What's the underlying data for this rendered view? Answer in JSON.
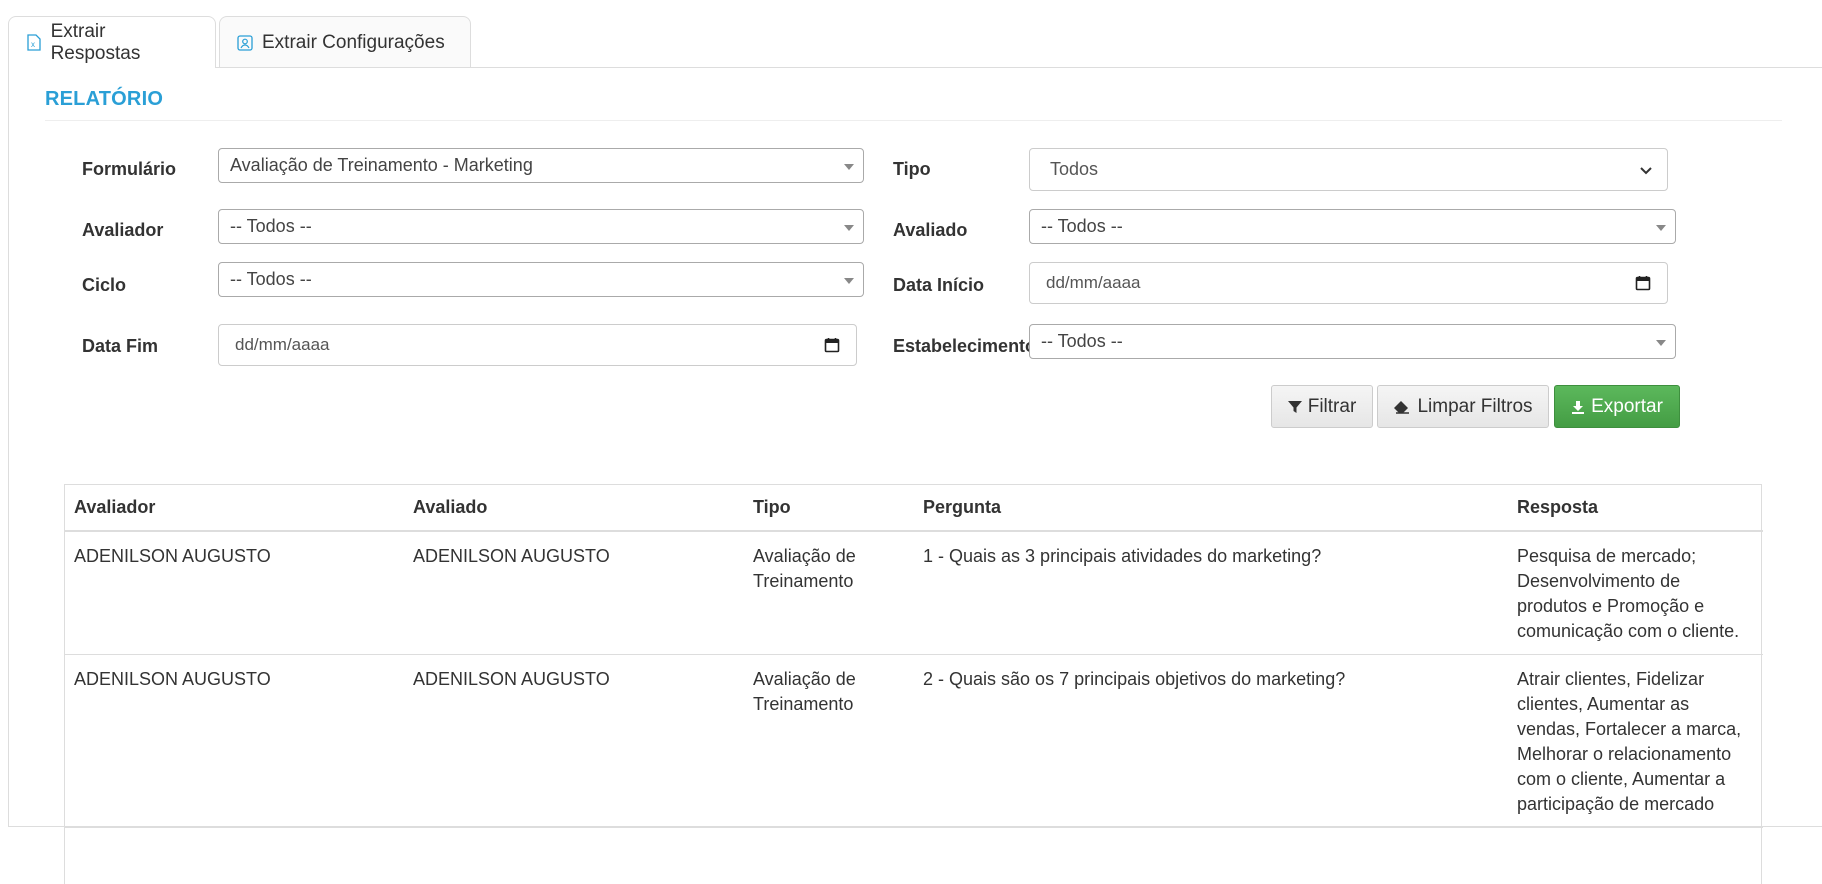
{
  "tabs": [
    {
      "label": "Extrair Respostas",
      "icon": "excel-file-icon"
    },
    {
      "label": "Extrair Configurações",
      "icon": "settings-file-icon"
    }
  ],
  "section_title": "RELATÓRIO",
  "filters": {
    "formulario": {
      "label": "Formulário",
      "value": "Avaliação de Treinamento - Marketing"
    },
    "tipo": {
      "label": "Tipo",
      "value": "Todos"
    },
    "avaliador": {
      "label": "Avaliador",
      "value": "-- Todos --"
    },
    "avaliado": {
      "label": "Avaliado",
      "value": "-- Todos --"
    },
    "ciclo": {
      "label": "Ciclo",
      "value": "-- Todos --"
    },
    "data_inicio": {
      "label": "Data Início",
      "placeholder": "dd/mm/aaaa"
    },
    "data_fim": {
      "label": "Data Fim",
      "placeholder": "dd/mm/aaaa"
    },
    "estabelecimento": {
      "label": "Estabelecimento",
      "value": "-- Todos --"
    }
  },
  "buttons": {
    "filtrar": "Filtrar",
    "limpar": "Limpar Filtros",
    "exportar": "Exportar"
  },
  "table": {
    "headers": [
      "Avaliador",
      "Avaliado",
      "Tipo",
      "Pergunta",
      "Resposta"
    ],
    "rows": [
      {
        "avaliador": "ADENILSON AUGUSTO",
        "avaliado": "ADENILSON AUGUSTO",
        "tipo": "Avaliação de Treinamento",
        "pergunta": "1 - Quais as 3 principais atividades do marketing?",
        "resposta": "Pesquisa de mercado; Desenvolvimento de produtos e Promoção e comunicação com o cliente."
      },
      {
        "avaliador": "ADENILSON AUGUSTO",
        "avaliado": "ADENILSON AUGUSTO",
        "tipo": "Avaliação de Treinamento",
        "pergunta": "2 - Quais são os 7 principais objetivos do marketing?",
        "resposta": "Atrair clientes, Fidelizar clientes, Aumentar as vendas, Fortalecer a marca, Melhorar o relacionamento com o cliente, Aumentar a participação de mercado"
      }
    ]
  },
  "colors": {
    "accent": "#2a9fd6",
    "success": "#5cb85c"
  }
}
